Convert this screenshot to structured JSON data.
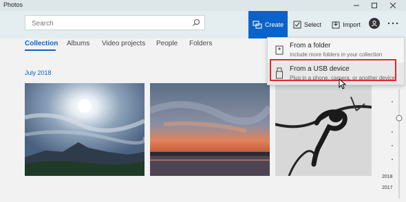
{
  "window": {
    "title": "Photos",
    "controls": [
      "minimize",
      "maximize",
      "close"
    ]
  },
  "header": {
    "search": {
      "placeholder": "Search",
      "value": ""
    },
    "buttons": {
      "create": "Create",
      "select": "Select",
      "import": "Import"
    },
    "accent_color": "#0a63c9"
  },
  "nav": {
    "tabs": [
      {
        "label": "Collection",
        "active": true
      },
      {
        "label": "Albums"
      },
      {
        "label": "Video projects"
      },
      {
        "label": "People"
      },
      {
        "label": "Folders"
      }
    ]
  },
  "content": {
    "date_heading": "July 2018",
    "photos": [
      {
        "subject": "cloudy sky with sun over mountains"
      },
      {
        "subject": "sunset over sea"
      },
      {
        "subject": "monkey silhouette on branch"
      }
    ]
  },
  "timeline": {
    "years": [
      "2018",
      "2017"
    ]
  },
  "dropdown": {
    "items": [
      {
        "title": "From a folder",
        "subtitle": "Include more folders in your collection",
        "icon": "folder-icon"
      },
      {
        "title": "From a USB device",
        "subtitle": "Plug in a phone, camera, or another device",
        "icon": "usb-icon",
        "highlighted": true
      }
    ],
    "highlight_color": "#e0262d"
  }
}
